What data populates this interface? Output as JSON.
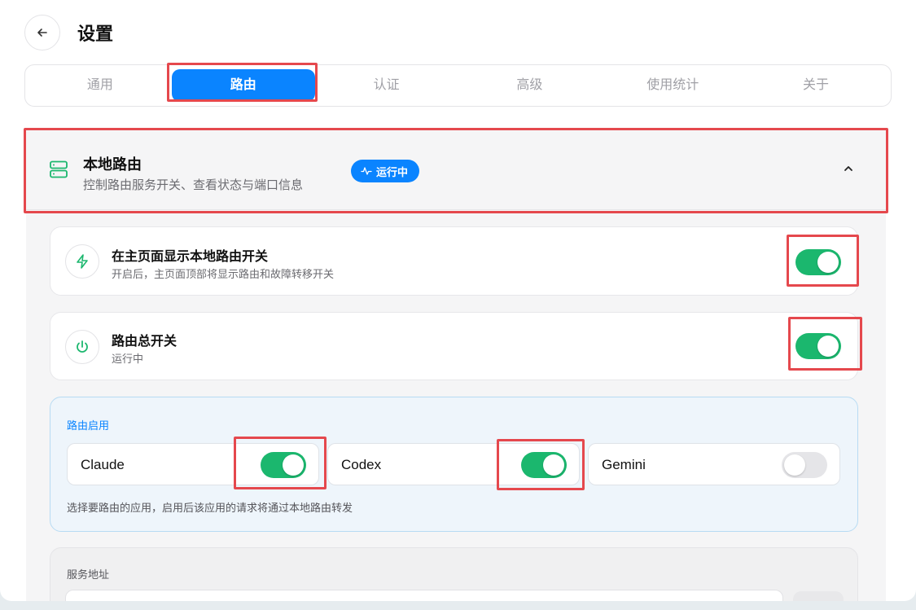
{
  "header": {
    "title": "设置",
    "back_icon": "arrow-left-icon"
  },
  "tabs": [
    {
      "label": "通用",
      "active": false
    },
    {
      "label": "路由",
      "active": true
    },
    {
      "label": "认证",
      "active": false
    },
    {
      "label": "高级",
      "active": false
    },
    {
      "label": "使用统计",
      "active": false
    },
    {
      "label": "关于",
      "active": false
    }
  ],
  "section": {
    "title": "本地路由",
    "subtitle": "控制路由服务开关、查看状态与端口信息",
    "badge": "运行中",
    "icon": "server-icon",
    "expanded": true
  },
  "settings": [
    {
      "title": "在主页面显示本地路由开关",
      "subtitle": "开启后，主页面顶部将显示路由和故障转移开关",
      "icon": "lightning-icon",
      "enabled": true
    },
    {
      "title": "路由总开关",
      "subtitle": "运行中",
      "icon": "power-icon",
      "enabled": true
    }
  ],
  "apps": {
    "label": "路由启用",
    "items": [
      {
        "name": "Claude",
        "enabled": true
      },
      {
        "name": "Codex",
        "enabled": true
      },
      {
        "name": "Gemini",
        "enabled": false
      }
    ],
    "hint": "选择要路由的应用，启用后该应用的请求将通过本地路由转发"
  },
  "address": {
    "label": "服务地址"
  },
  "colors": {
    "accent": "#0a84ff",
    "toggle_on": "#1bb76e",
    "highlight": "#e5484d"
  }
}
